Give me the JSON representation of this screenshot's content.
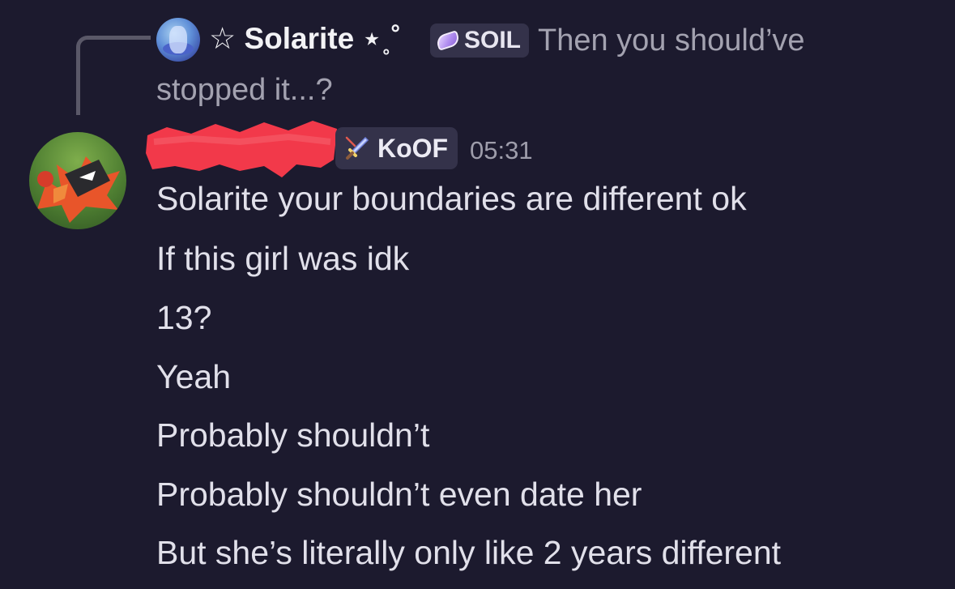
{
  "reply": {
    "author_name": "☆ Solarite ⋆˳˚",
    "author_tag": "SOIL",
    "tag_icon": "gem-icon",
    "text_line1": "Then you should’ve",
    "text_line2": "stopped it...?"
  },
  "message": {
    "author_name_redacted": true,
    "role_tag": "KoOF",
    "role_icon": "sword-icon",
    "timestamp": "05:31",
    "lines": [
      "Solarite your boundaries are different ok",
      "If this girl was idk",
      "13?",
      "Yeah",
      "Probably shouldn’t",
      "Probably shouldn’t even date her",
      "But she’s literally only like 2 years different"
    ]
  },
  "colors": {
    "background": "#1c1a2e",
    "tag_background": "#34324a",
    "redaction": "#f2394a",
    "muted_text": "#a3a2b0"
  }
}
